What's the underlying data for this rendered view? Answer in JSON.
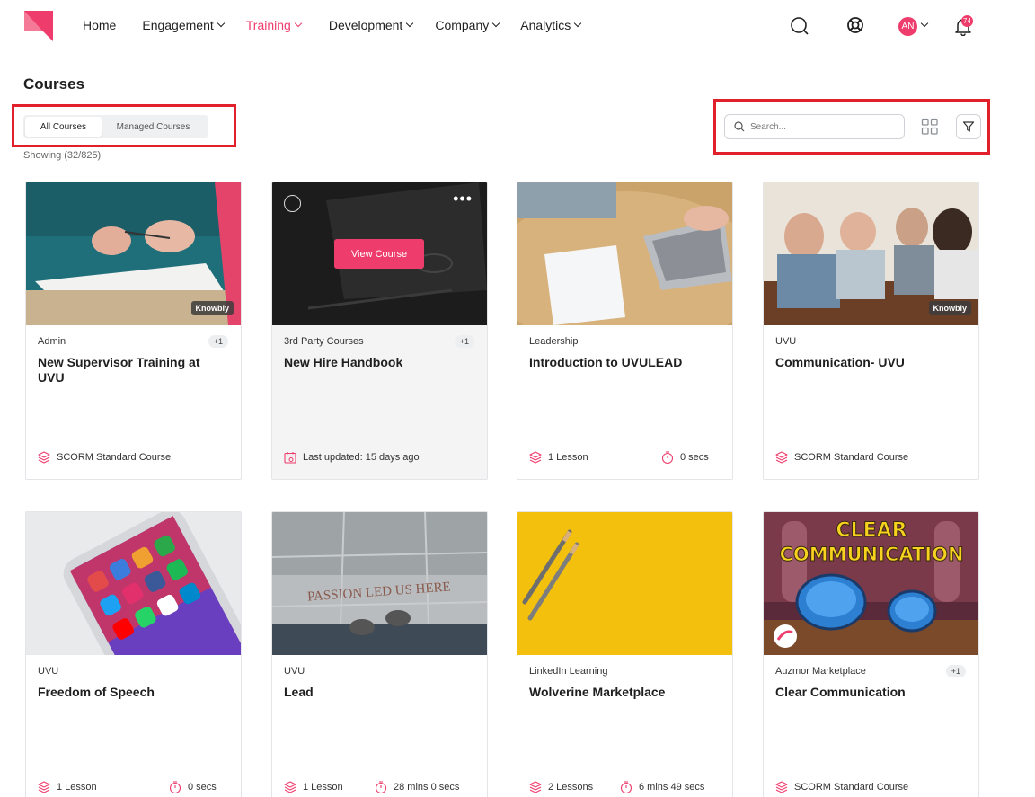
{
  "nav": {
    "items": [
      {
        "label": "Home",
        "has_menu": false,
        "active": false
      },
      {
        "label": "Engagement",
        "has_menu": true,
        "active": false
      },
      {
        "label": "Training",
        "has_menu": true,
        "active": true
      },
      {
        "label": "Development",
        "has_menu": true,
        "active": false
      },
      {
        "label": "Company",
        "has_menu": true,
        "active": false
      },
      {
        "label": "Analytics",
        "has_menu": true,
        "active": false
      }
    ],
    "avatar_initials": "AN",
    "notification_count": "74"
  },
  "page": {
    "title": "Courses",
    "tabs": [
      {
        "label": "All Courses",
        "active": true
      },
      {
        "label": "Managed Courses",
        "active": false
      }
    ],
    "showing": "Showing (32/825)",
    "search_placeholder": "Search..."
  },
  "colors": {
    "accent": "#ee3d6c",
    "highlight_box": "#e0202a"
  },
  "courses": [
    {
      "category": "Admin",
      "extra": "+1",
      "title": "New Supervisor Training at UVU",
      "provider_badge": "Knowbly",
      "meta_left": "SCORM Standard Course",
      "meta_left_icon": "layers-icon",
      "meta_right": ""
    },
    {
      "category": "3rd Party Courses",
      "extra": "+1",
      "title": "New Hire Handbook",
      "provider_badge": "",
      "meta_left": "Last updated: 15 days ago",
      "meta_left_icon": "calendar-icon",
      "meta_right": "",
      "hover_button": "View Course"
    },
    {
      "category": "Leadership",
      "extra": "",
      "title": "Introduction to UVULEAD",
      "provider_badge": "",
      "meta_left": "1 Lesson",
      "meta_left_icon": "layers-icon",
      "meta_right": "0 secs"
    },
    {
      "category": "UVU",
      "extra": "",
      "title": "Communication- UVU",
      "provider_badge": "Knowbly",
      "meta_left": "SCORM Standard Course",
      "meta_left_icon": "layers-icon",
      "meta_right": ""
    },
    {
      "category": "UVU",
      "extra": "",
      "title": "Freedom of Speech",
      "provider_badge": "",
      "meta_left": "1 Lesson",
      "meta_left_icon": "layers-icon",
      "meta_right": "0 secs"
    },
    {
      "category": "UVU",
      "extra": "",
      "title": "Lead",
      "provider_badge": "",
      "meta_left": "1 Lesson",
      "meta_left_icon": "layers-icon",
      "meta_right": "28 mins 0 secs",
      "thumb_text": "PASSION LED US HERE"
    },
    {
      "category": "LinkedIn Learning",
      "extra": "",
      "title": "Wolverine Marketplace",
      "provider_badge": "",
      "meta_left": "2 Lessons",
      "meta_left_icon": "layers-icon",
      "meta_right": "6 mins 49 secs"
    },
    {
      "category": "Auzmor Marketplace",
      "extra": "+1",
      "title": "Clear Communication",
      "provider_badge": "",
      "meta_left": "SCORM Standard Course",
      "meta_left_icon": "layers-icon",
      "meta_right": "",
      "thumb_text_1": "CLEAR",
      "thumb_text_2": "COMMUNICATION"
    }
  ]
}
